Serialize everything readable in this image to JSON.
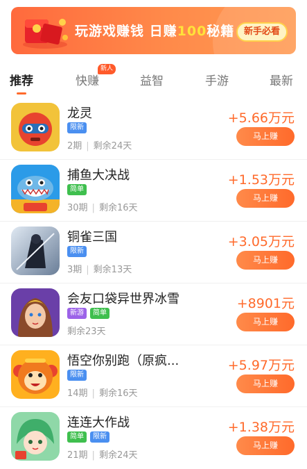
{
  "banner": {
    "text_part1": "玩游戏赚钱 日赚",
    "text_highlight": "100",
    "text_part2": "秘籍",
    "cta_label": "新手必看"
  },
  "tabs": [
    {
      "label": "推荐",
      "active": true
    },
    {
      "label": "快赚",
      "badge": "新人"
    },
    {
      "label": "益智"
    },
    {
      "label": "手游"
    },
    {
      "label": "最新"
    }
  ],
  "games": [
    {
      "name": "龙灵",
      "tags": [
        "限新"
      ],
      "meta": [
        "2期",
        "剩余24天"
      ],
      "reward": "+5.66万元",
      "button": "马上赚",
      "icon": "robot-game-icon"
    },
    {
      "name": "捕鱼大决战",
      "tags": [
        "简单"
      ],
      "meta": [
        "30期",
        "剩余16天"
      ],
      "reward": "+1.53万元",
      "button": "马上赚",
      "icon": "shark-fishing-game-icon"
    },
    {
      "name": "铜雀三国",
      "tags": [
        "限新"
      ],
      "meta": [
        "3期",
        "剩余13天"
      ],
      "reward": "+3.05万元",
      "button": "马上赚",
      "icon": "swordsman-game-icon"
    },
    {
      "name": "会友口袋异世界冰雪",
      "tags": [
        "新游",
        "简单"
      ],
      "meta": [
        "剩余23天"
      ],
      "reward": "+8901元",
      "button": "马上赚",
      "icon": "heroine-game-icon"
    },
    {
      "name": "悟空你别跑（原疯...",
      "tags": [
        "限新"
      ],
      "meta": [
        "14期",
        "剩余16天"
      ],
      "reward": "+5.97万元",
      "button": "马上赚",
      "icon": "monkey-game-icon"
    },
    {
      "name": "连连大作战",
      "tags": [
        "简单",
        "限新"
      ],
      "meta": [
        "21期",
        "剩余24天"
      ],
      "reward": "+1.38万元",
      "button": "马上赚",
      "icon": "girl-game-icon"
    }
  ],
  "colors": {
    "accent": "#ff6a2b",
    "tag_blue": "#4a8ff0",
    "tag_green": "#3fbf4e",
    "tag_purple": "#9c62e8"
  }
}
